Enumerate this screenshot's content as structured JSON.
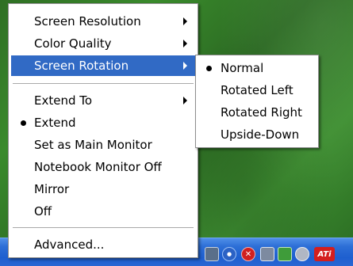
{
  "colors": {
    "highlight": "#316ac5",
    "taskbar": "#2c6ed6",
    "desktop": "#3a8a2c"
  },
  "main_menu": {
    "items": [
      {
        "label": "Screen Resolution",
        "submenu": true
      },
      {
        "label": "Color Quality",
        "submenu": true
      },
      {
        "label": "Screen Rotation",
        "submenu": true,
        "highlighted": true
      },
      {
        "label": "Extend To",
        "submenu": true
      },
      {
        "label": "Extend",
        "checked": true
      },
      {
        "label": "Set as Main Monitor"
      },
      {
        "label": "Notebook Monitor Off"
      },
      {
        "label": "Mirror"
      },
      {
        "label": "Off"
      },
      {
        "label": "Advanced..."
      }
    ]
  },
  "rotation_submenu": {
    "items": [
      {
        "label": "Normal",
        "checked": true
      },
      {
        "label": "Rotated Left"
      },
      {
        "label": "Rotated Right"
      },
      {
        "label": "Upside-Down"
      }
    ]
  },
  "taskbar": {
    "tray_icons": [
      "monitor-icon",
      "network-icon",
      "security-shield-icon",
      "display-icon",
      "safely-remove-icon",
      "volume-icon",
      "ati-icon"
    ],
    "ati_label": "ATi"
  }
}
